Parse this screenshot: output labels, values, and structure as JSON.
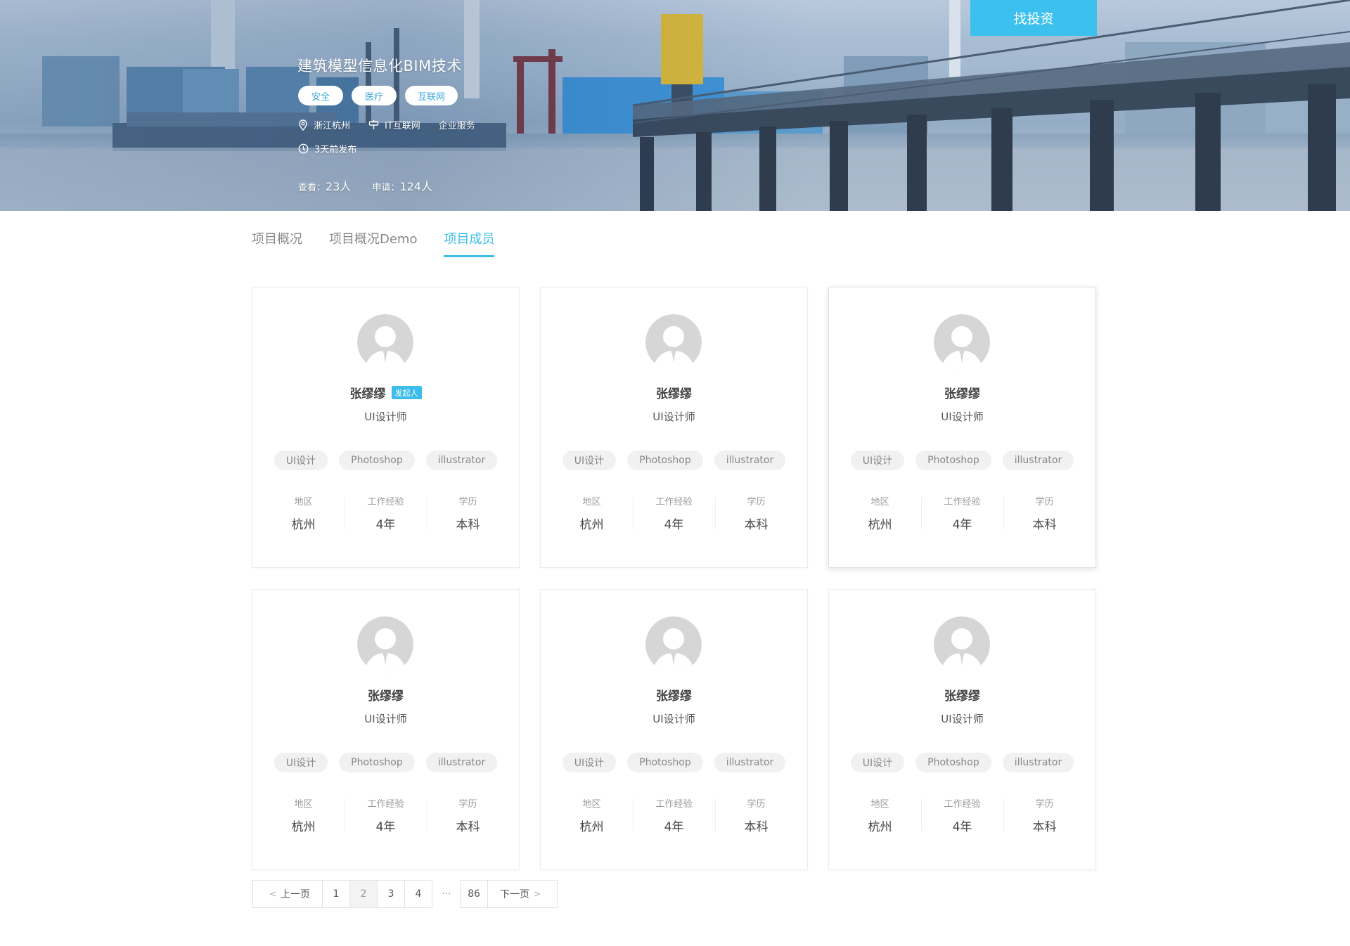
{
  "banner": {
    "invest_button": "找投资",
    "title": "建筑模型信息化BIM技术",
    "tags": [
      "安全",
      "医疗",
      "互联网"
    ],
    "location": "浙江杭州",
    "industry": "IT互联网",
    "service": "企业服务",
    "published": "3天前发布",
    "views_label": "查看：",
    "views_value": "23人",
    "applies_label": "申请：",
    "applies_value": "124人"
  },
  "tabs": [
    {
      "label": "项目概况",
      "active": false
    },
    {
      "label": "项目概况Demo",
      "active": false
    },
    {
      "label": "项目成员",
      "active": true
    }
  ],
  "members": [
    {
      "name": "张缪缪",
      "badge": "发起人",
      "role": "UI设计师",
      "skills": [
        "UI设计",
        "Photoshop",
        "illustrator"
      ],
      "region_label": "地区",
      "region": "杭州",
      "exp_label": "工作经验",
      "exp": "4年",
      "edu_label": "学历",
      "edu": "本科"
    },
    {
      "name": "张缪缪",
      "badge": "",
      "role": "UI设计师",
      "skills": [
        "UI设计",
        "Photoshop",
        "illustrator"
      ],
      "region_label": "地区",
      "region": "杭州",
      "exp_label": "工作经验",
      "exp": "4年",
      "edu_label": "学历",
      "edu": "本科"
    },
    {
      "name": "张缪缪",
      "badge": "",
      "role": "UI设计师",
      "skills": [
        "UI设计",
        "Photoshop",
        "illustrator"
      ],
      "region_label": "地区",
      "region": "杭州",
      "exp_label": "工作经验",
      "exp": "4年",
      "edu_label": "学历",
      "edu": "本科"
    },
    {
      "name": "张缪缪",
      "badge": "",
      "role": "UI设计师",
      "skills": [
        "UI设计",
        "Photoshop",
        "illustrator"
      ],
      "region_label": "地区",
      "region": "杭州",
      "exp_label": "工作经验",
      "exp": "4年",
      "edu_label": "学历",
      "edu": "本科"
    },
    {
      "name": "张缪缪",
      "badge": "",
      "role": "UI设计师",
      "skills": [
        "UI设计",
        "Photoshop",
        "illustrator"
      ],
      "region_label": "地区",
      "region": "杭州",
      "exp_label": "工作经验",
      "exp": "4年",
      "edu_label": "学历",
      "edu": "本科"
    },
    {
      "name": "张缪缪",
      "badge": "",
      "role": "UI设计师",
      "skills": [
        "UI设计",
        "Photoshop",
        "illustrator"
      ],
      "region_label": "地区",
      "region": "杭州",
      "exp_label": "工作经验",
      "exp": "4年",
      "edu_label": "学历",
      "edu": "本科"
    }
  ],
  "pagination": {
    "prev_label": "上一页",
    "next_label": "下一页",
    "prev_arrow": "<",
    "next_arrow": ">",
    "pages": [
      "1",
      "2",
      "3",
      "4"
    ],
    "current": "2",
    "ellipsis": "···",
    "last": "86"
  },
  "colors": {
    "accent": "#3cbdea",
    "invest_button": "#3cc1ee",
    "tag_text": "#3aa5df"
  }
}
